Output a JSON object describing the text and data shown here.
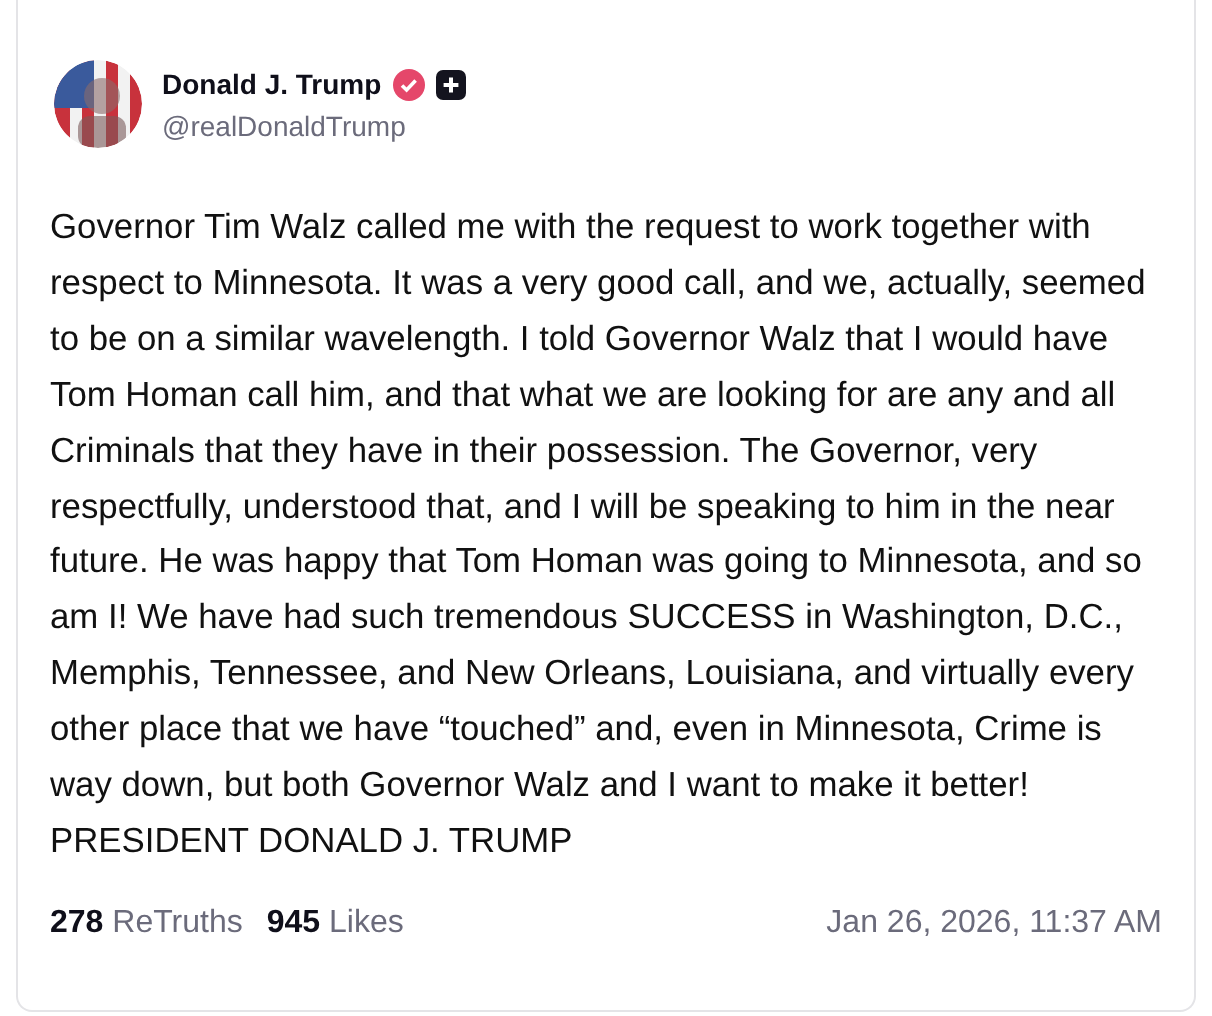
{
  "post": {
    "author": {
      "name": "Donald J. Trump",
      "handle": "@realDonaldTrump",
      "verified": true
    },
    "text": "Governor Tim Walz called me with the request to work together with respect to Minnesota. It was a very good call, and we, actually, seemed to be on a similar wavelength. I told Governor Walz that I would have Tom Homan call him, and that what we are looking for are any and all Criminals that they have in their possession. The Governor, very respectfully, understood that, and I will be speaking to him in the near future. He was happy that Tom Homan was going to Minnesota, and so am I! We have had such tremendous SUCCESS in Washington, D.C., Memphis, Tennessee, and New Orleans, Louisiana, and virtually every other place that we have “touched” and, even in Minnesota, Crime is way down, but both Governor Walz and I want to make it better! PRESIDENT DONALD J. TRUMP",
    "stats": [
      {
        "count": "278",
        "label": "ReTruths"
      },
      {
        "count": "945",
        "label": "Likes"
      }
    ],
    "timestamp": "Jan 26, 2026, 11:37 AM"
  }
}
